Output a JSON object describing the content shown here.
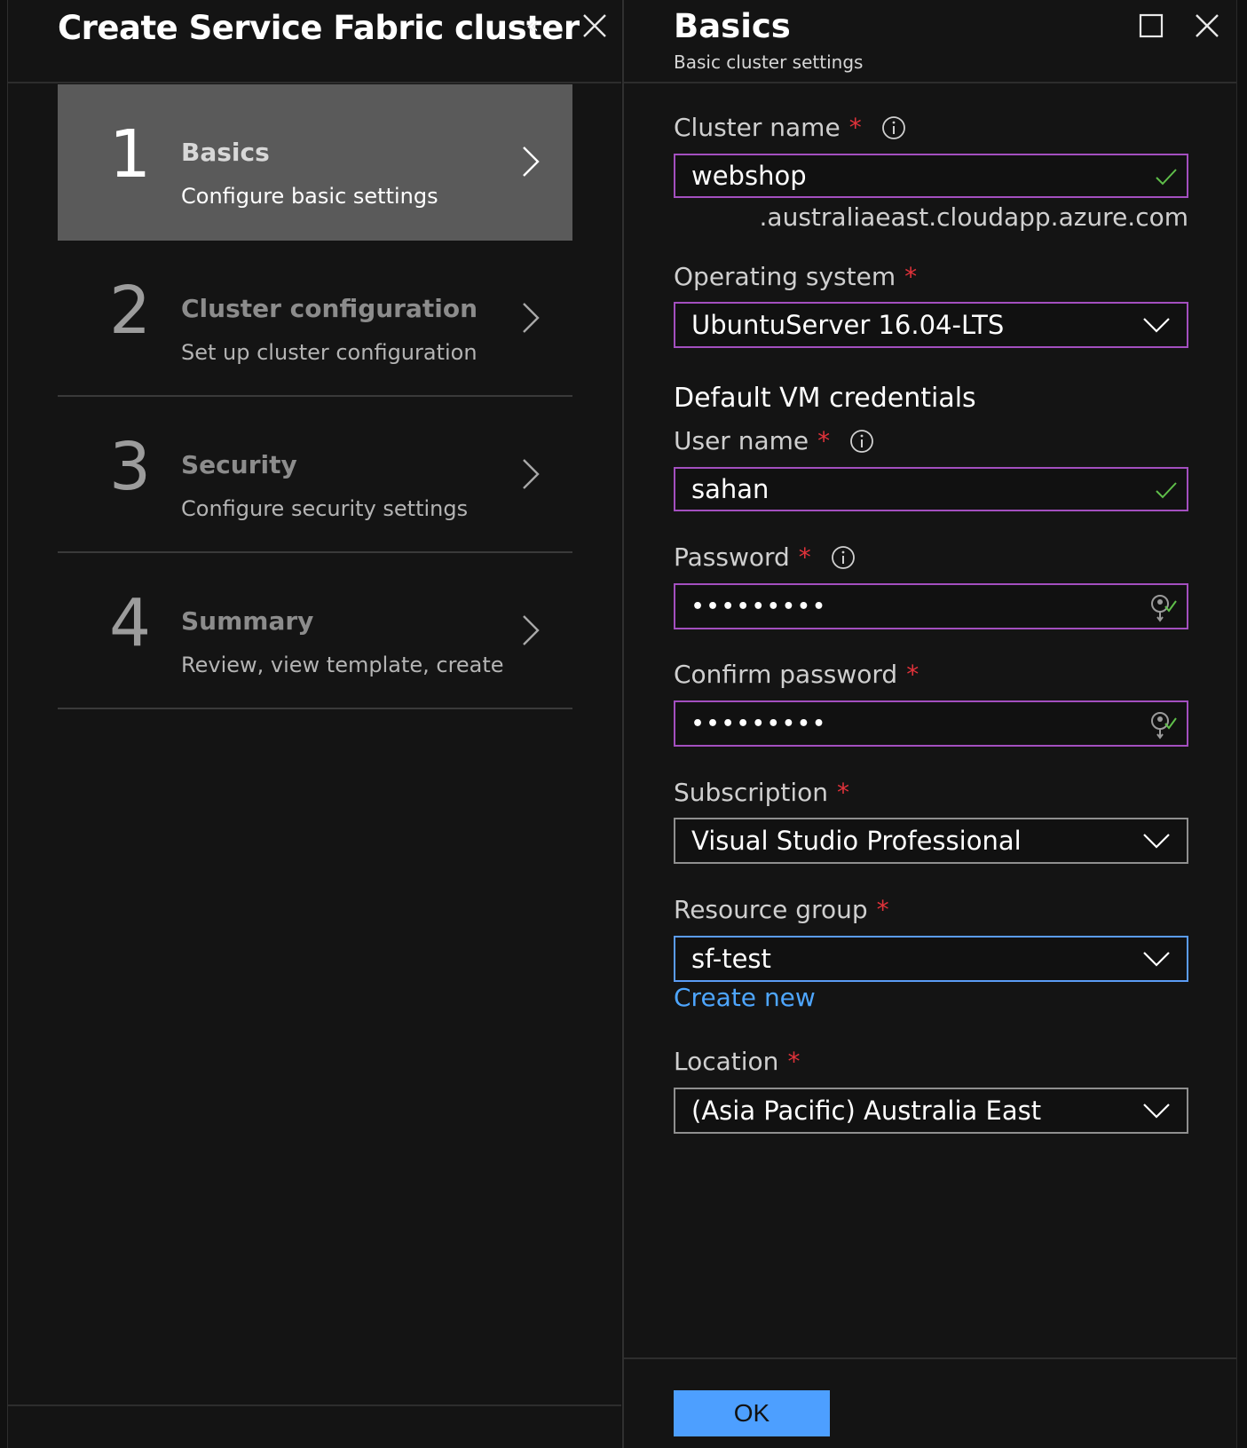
{
  "left_blade": {
    "title": "Create Service Fabric cluster",
    "collapse_glyph": "«",
    "steps": [
      {
        "number": "1",
        "title": "Basics",
        "subtitle": "Configure basic settings",
        "active": true
      },
      {
        "number": "2",
        "title": "Cluster configuration",
        "subtitle": "Set up cluster configuration",
        "active": false
      },
      {
        "number": "3",
        "title": "Security",
        "subtitle": "Configure security settings",
        "active": false
      },
      {
        "number": "4",
        "title": "Summary",
        "subtitle": "Review, view template, create",
        "active": false
      }
    ]
  },
  "right_blade": {
    "title": "Basics",
    "subtitle": "Basic cluster settings",
    "fields": {
      "cluster_name": {
        "label": "Cluster name",
        "value": "webshop",
        "suffix": ".australiaeast.cloudapp.azure.com"
      },
      "operating_system": {
        "label": "Operating system",
        "value": "UbuntuServer 16.04-LTS"
      },
      "credentials_heading": "Default VM credentials",
      "user_name": {
        "label": "User name",
        "value": "sahan"
      },
      "password": {
        "label": "Password",
        "value": "•••••••••"
      },
      "confirm_password": {
        "label": "Confirm password",
        "value": "•••••••••"
      },
      "subscription": {
        "label": "Subscription",
        "value": "Visual Studio Professional"
      },
      "resource_group": {
        "label": "Resource group",
        "value": "sf-test",
        "create_link": "Create new"
      },
      "location": {
        "label": "Location",
        "value": "(Asia Pacific) Australia East"
      }
    },
    "required_marker": "*",
    "ok_label": "OK"
  },
  "colors": {
    "valid_border": "#a34fbf",
    "focus_border": "#5b9cf5",
    "required_star": "#e0323a",
    "link": "#4ea6ff",
    "ok_button": "#4d9fff",
    "checkmark": "#5fbf4a"
  },
  "icons": [
    "collapse-icon",
    "close-icon",
    "maximize-icon",
    "chevron-right-icon",
    "info-icon",
    "checkmark-icon",
    "key-icon",
    "chevron-down-icon"
  ]
}
